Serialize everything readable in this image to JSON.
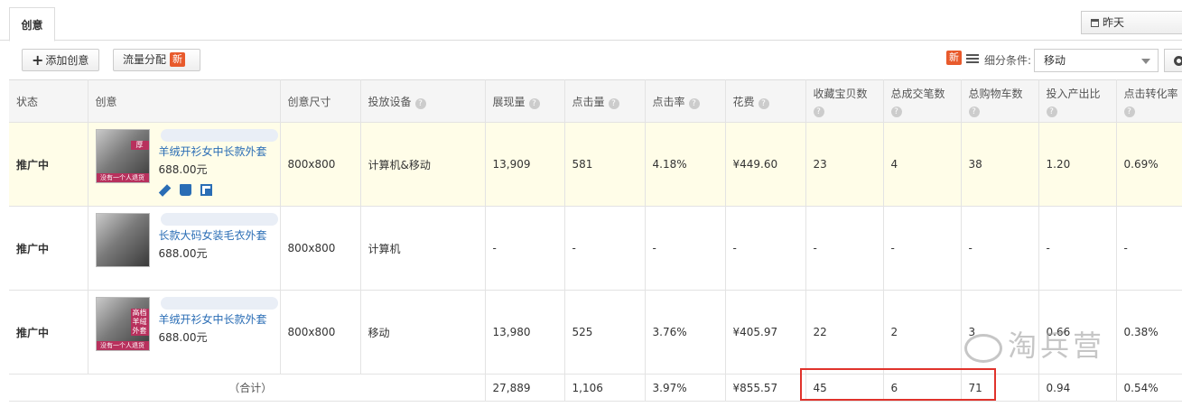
{
  "tabs": [
    {
      "label": "创意"
    }
  ],
  "date_picker": {
    "label": "昨天"
  },
  "toolbar": {
    "add_label": "添加创意",
    "flow_label": "流量分配",
    "new_badge": "新",
    "filter_new_badge": "新",
    "filter_label": "细分条件:",
    "filter_value": "移动"
  },
  "table": {
    "headers": [
      "状态",
      "创意",
      "创意尺寸",
      "投放设备",
      "展现量",
      "点击量",
      "点击率",
      "花费",
      "收藏宝贝数",
      "总成交笔数",
      "总购物车数",
      "投入产出比",
      "点击转化率"
    ],
    "rows": [
      {
        "status": "推广中",
        "title": "羊绒开衫女中长款外套",
        "price": "688.00元",
        "thumb_tag": "厚",
        "thumb_banner": "没有一个人退货",
        "size": "800x800",
        "device": "计算机&移动",
        "impressions": "13,909",
        "clicks": "581",
        "ctr": "4.18%",
        "cost": "¥449.60",
        "favorites": "23",
        "orders": "4",
        "cart": "38",
        "roi": "1.20",
        "cvr": "0.69%"
      },
      {
        "status": "推广中",
        "title": "长款大码女装毛衣外套",
        "price": "688.00元",
        "thumb_tag": "",
        "thumb_banner": "",
        "size": "800x800",
        "device": "计算机",
        "impressions": "-",
        "clicks": "-",
        "ctr": "-",
        "cost": "-",
        "favorites": "-",
        "orders": "-",
        "cart": "-",
        "roi": "-",
        "cvr": "-"
      },
      {
        "status": "推广中",
        "title": "羊绒开衫女中长款外套",
        "price": "688.00元",
        "thumb_tag": "高档羊绒外套",
        "thumb_banner": "没有一个人退货",
        "size": "800x800",
        "device": "移动",
        "impressions": "13,980",
        "clicks": "525",
        "ctr": "3.76%",
        "cost": "¥405.97",
        "favorites": "22",
        "orders": "2",
        "cart": "3",
        "roi": "0.66",
        "cvr": "0.38%"
      }
    ],
    "total": {
      "label": "（合计）",
      "impressions": "27,889",
      "clicks": "1,106",
      "ctr": "3.97%",
      "cost": "¥855.57",
      "favorites": "45",
      "orders": "6",
      "cart": "71",
      "roi": "0.94",
      "cvr": "0.54%"
    }
  },
  "watermark": "淘兵营",
  "colors": {
    "status_active": "#3b8d14",
    "link": "#2a6db5",
    "badge": "#e85a2c",
    "highlight_box": "#e0332c",
    "row_highlight": "#fffde8"
  },
  "icons": [
    "calendar-icon",
    "plus-icon",
    "list-icon",
    "caret-down-icon",
    "gear-icon",
    "help-icon",
    "edit-icon",
    "delete-icon",
    "copy-icon"
  ]
}
